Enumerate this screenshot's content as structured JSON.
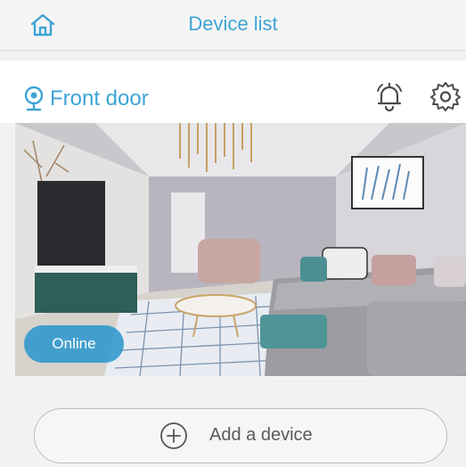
{
  "header": {
    "title": "Device list",
    "home_icon": "home-icon"
  },
  "device": {
    "name": "Front door",
    "camera_icon": "camera-icon",
    "status": "Online",
    "actions": [
      "bell-icon",
      "gear-icon"
    ]
  },
  "footer": {
    "add_label": "Add a device",
    "add_icon": "plus-circle-icon"
  },
  "colors": {
    "accent": "#3ea4d4",
    "badge": "#2896cd",
    "background": "#f2f2f2"
  }
}
